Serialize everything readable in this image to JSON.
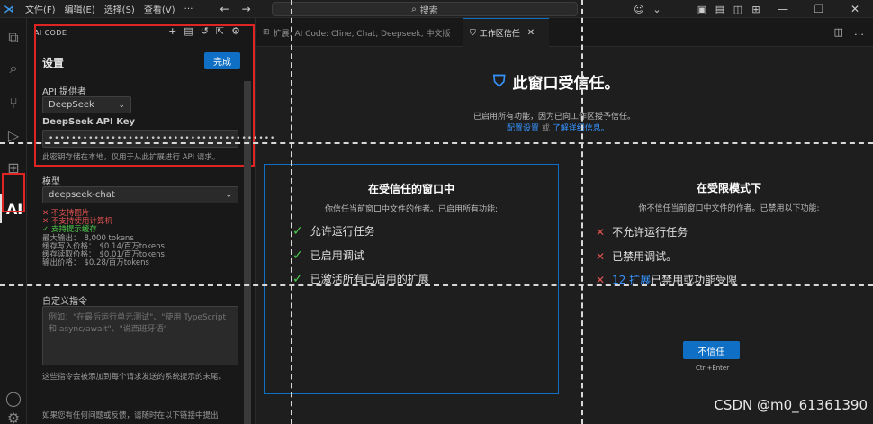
{
  "titlebar": {
    "menus": [
      "文件(F)",
      "编辑(E)",
      "选择(S)",
      "查看(V)",
      "…"
    ],
    "search_placeholder": "搜索"
  },
  "side": {
    "header": "AI CODE",
    "settings_title": "设置",
    "done_label": "完成",
    "api_provider_label": "API 提供者",
    "api_provider_value": "DeepSeek",
    "api_key_label": "DeepSeek API Key",
    "api_key_value": "••••••••••••••••••••••••••••••••••••••••",
    "api_key_note": "此密钥存储在本地，仅用于从此扩展进行 API 请求。",
    "model_label": "模型",
    "model_value": "deepseek-chat",
    "capabilities": {
      "no_images": "不支持图片",
      "no_computer": "不支持使用计算机",
      "prompt_cache": "支持提示缓存",
      "max_output_label": "最大输出：",
      "max_output_value": "8,000 tokens",
      "cache_write_label": "缓存写入价格：",
      "cache_write_value": "$0.14/百万tokens",
      "cache_read_label": "缓存读取价格：",
      "cache_read_value": "$0.01/百万tokens",
      "output_price_label": "输出价格：",
      "output_price_value": "$0.28/百万tokens"
    },
    "custom_instructions_label": "自定义指令",
    "custom_instructions_placeholder": "例如：\"在最后运行单元测试\"、\"使用 TypeScript 和 async/await\"、\"说西班牙语\"",
    "custom_instructions_note": "这些指令会被添加到每个请求发送的系统提示的末尾。",
    "bottom_note": "如果您有任何问题或反馈，请随时在以下链接中提出"
  },
  "tabs": [
    {
      "label": "扩展: AI Code: Cline, Chat, Deepseek, 中文版"
    },
    {
      "label": "工作区信任"
    }
  ],
  "editor": {
    "title": "此窗口受信任。",
    "subtitle": "已启用所有功能，因为已向工作区授予信任。",
    "links_config": "配置设置",
    "links_or": "或",
    "links_learn": "了解详细信息。",
    "trusted": {
      "title": "在受信任的窗口中",
      "desc": "你信任当前窗口中文件的作者。已启用所有功能:",
      "items": [
        "允许运行任务",
        "已启用调试",
        "已激活所有已启用的扩展"
      ]
    },
    "restricted": {
      "title": "在受限模式下",
      "desc": "你不信任当前窗口中文件的作者。已禁用以下功能:",
      "items": [
        "不允许运行任务",
        "已禁用调试。"
      ],
      "ext_link": "12 扩展",
      "ext_text": "已禁用或功能受限",
      "button": "不信任",
      "hint": "Ctrl+Enter"
    }
  },
  "watermark": "CSDN @m0_61361390",
  "colors": {
    "accent": "#0e6fc4",
    "highlight": "#e02424",
    "ok": "#4ec94e",
    "bad": "#e05252",
    "link": "#3794ff"
  }
}
